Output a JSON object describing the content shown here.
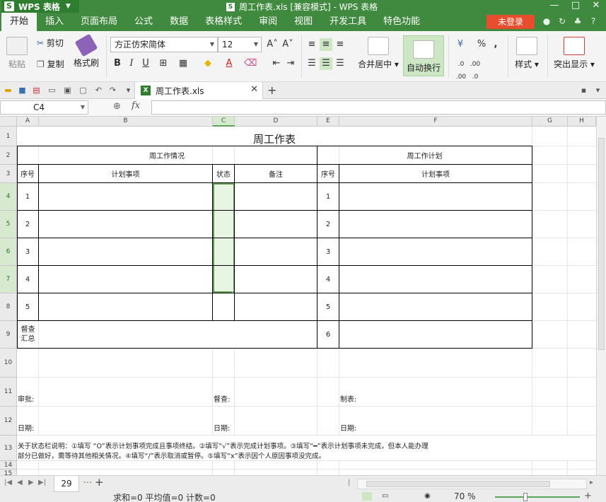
{
  "titlebar": {
    "app_name": "WPS 表格",
    "window_title": "周工作表.xls [兼容模式] - WPS 表格"
  },
  "menu": {
    "items": [
      "开始",
      "插入",
      "页面布局",
      "公式",
      "数据",
      "表格样式",
      "审阅",
      "视图",
      "开发工具",
      "特色功能"
    ],
    "login": "未登录"
  },
  "ribbon": {
    "paste": "粘贴",
    "cut": "剪切",
    "copy": "复制",
    "format_painter": "格式刷",
    "font_name": "方正仿宋简体",
    "font_size": "12",
    "merge_center": "合并居中",
    "wrap_text": "自动换行",
    "percent": "%",
    "comma": ",",
    "style": "样式",
    "highlight": "突出显示"
  },
  "doc_tab": {
    "name": "周工作表.xls"
  },
  "formula_bar": {
    "cell_ref": "C4",
    "fx": "fx",
    "value": ""
  },
  "columns": [
    "A",
    "B",
    "C",
    "D",
    "E",
    "F",
    "G",
    "H"
  ],
  "rows": [
    "1",
    "2",
    "3",
    "4",
    "5",
    "6",
    "7",
    "8",
    "9",
    "10",
    "11",
    "12",
    "13",
    "14",
    "15"
  ],
  "sheet": {
    "title": "周工作表",
    "left_section": "周工作情况",
    "right_section": "周工作计划",
    "hdr_seq": "序号",
    "hdr_plan": "计划事项",
    "hdr_status": "状态",
    "hdr_note": "备注",
    "hdr_seq2": "序号",
    "hdr_plan2": "计划事项",
    "left_nums": [
      "1",
      "2",
      "3",
      "4",
      "5"
    ],
    "right_nums": [
      "1",
      "2",
      "3",
      "4",
      "5",
      "6"
    ],
    "summary_label": "督查汇总",
    "approve": "审批:",
    "inspect": "督查:",
    "prepared": "制表:",
    "date1": "日期:",
    "date2": "日期:",
    "date3": "日期:",
    "note_line1": "关于状态栏说明：①填写 “O”表示计划事项完成且事项终结。②填写“√”表示完成计划事项。③填写“━”表示计划事项未完成，但本人能办理",
    "note_line2": "部分已做好，需等待其他相关情况。④填写“/”表示取消或暂停。⑤填写“x”表示因个人原因事项没完成。"
  },
  "tabs": {
    "sheet_name": "29"
  },
  "status": {
    "stats": "求和=0  平均值=0  计数=0",
    "zoom": "70 %"
  }
}
